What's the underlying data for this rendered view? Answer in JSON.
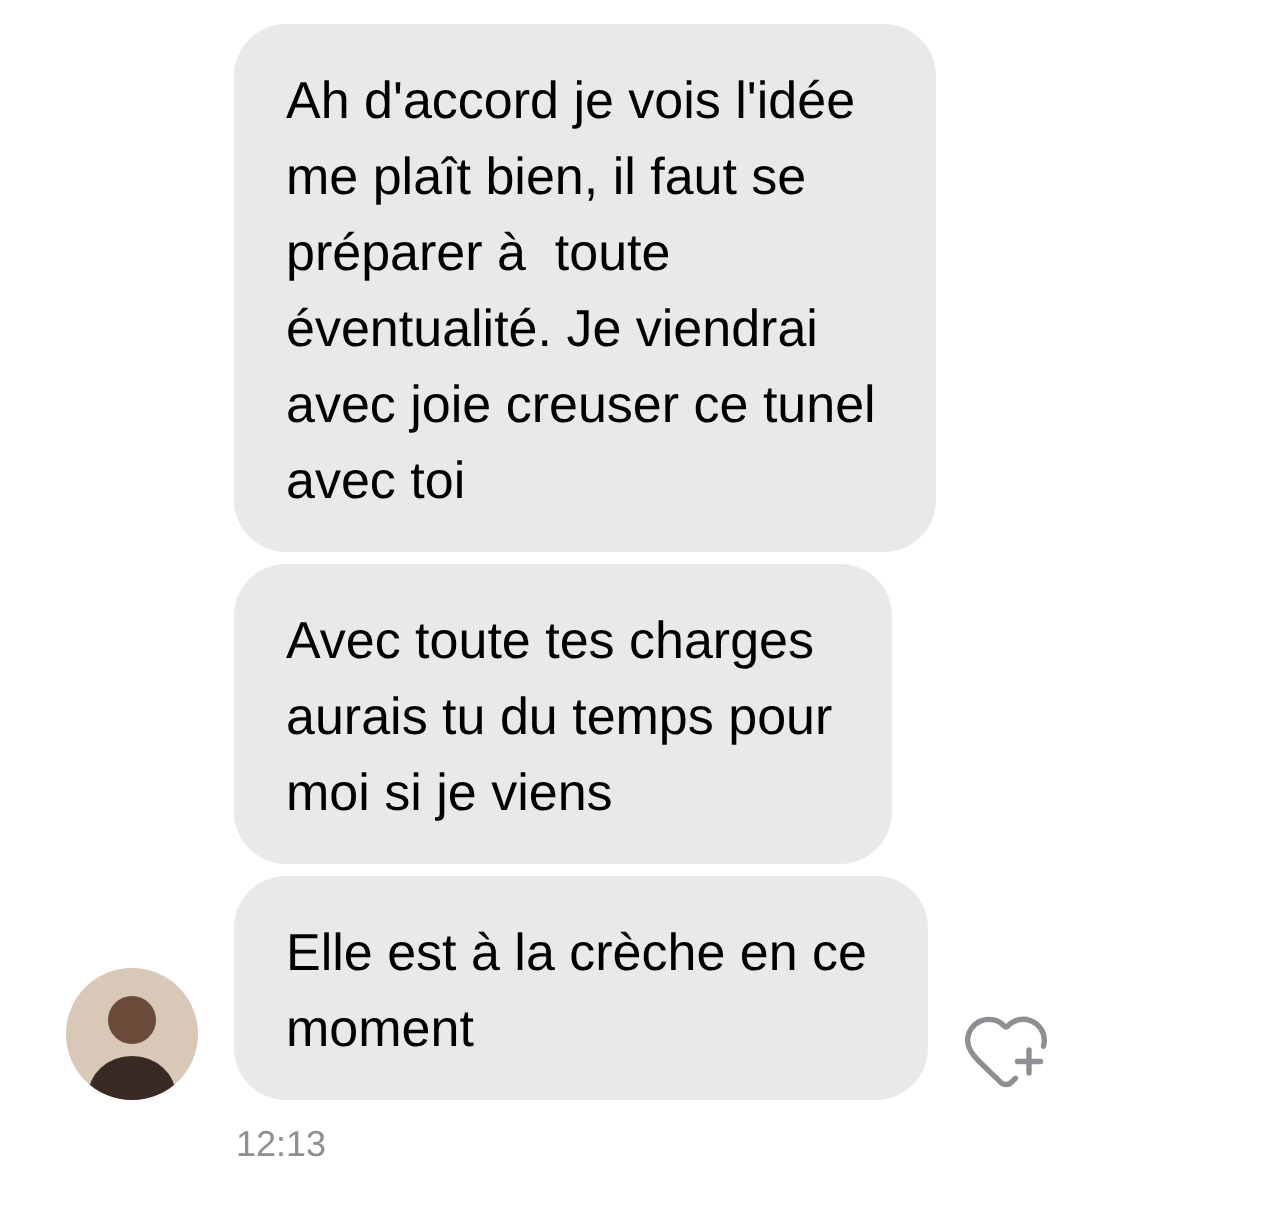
{
  "messages": [
    {
      "lines": [
        "Ah d'accord je vois l'idée",
        "me plaît bien, il faut se",
        "préparer à  toute",
        "éventualité. Je viendrai",
        "avec joie creuser ce tunel",
        "avec toi"
      ]
    },
    {
      "lines": [
        "Avec toute tes charges",
        "aurais tu du temps pour",
        "moi si je viens"
      ]
    },
    {
      "lines": [
        "Elle est à la crèche en ce",
        "moment"
      ]
    }
  ],
  "time": "12:13"
}
